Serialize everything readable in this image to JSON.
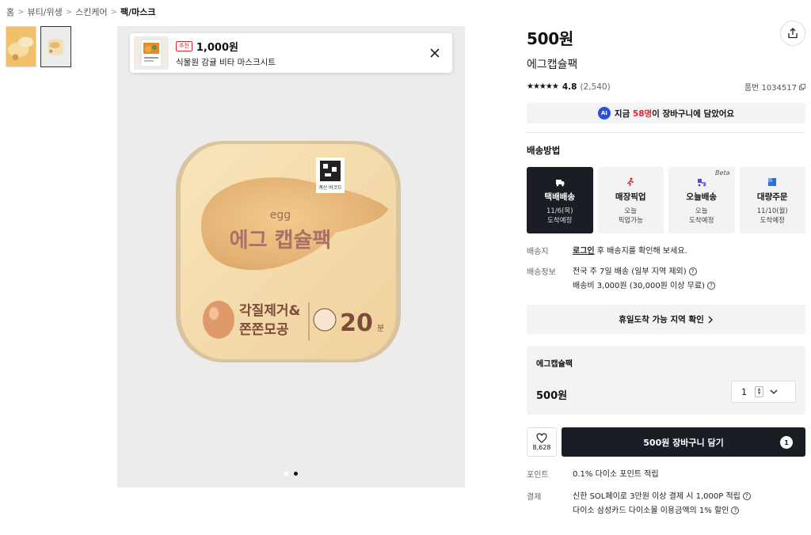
{
  "breadcrumb": [
    "홈",
    "뷰티/위생",
    "스킨케어",
    "팩/마스크"
  ],
  "breadcrumb_sep": ">",
  "recommend": {
    "badge": "추천",
    "price": "1,000원",
    "name": "식물원 감귤 비타 마스크시트"
  },
  "product_image": {
    "barcode_label": "계산 바코드",
    "eng": "egg",
    "title": "에그 캡슐팩",
    "feature1": "각질제거&",
    "feature2": "쫀쫀모공",
    "minutes": "20",
    "minutes_unit": "분",
    "thumb_label": "에그 캡슐"
  },
  "gallery": {
    "slide_count": 2,
    "active_slide": 2
  },
  "product": {
    "price": "500원",
    "name": "에그캡슐팩",
    "stars": "★★★★★",
    "rating": "4.8",
    "review_count": "(2,540)",
    "sku": "품번 1034517"
  },
  "cart_notice": {
    "ai": "AI",
    "prefix": "지금 ",
    "count": "58명",
    "suffix": "이 장바구니에 담았어요"
  },
  "shipping": {
    "title": "배송방법",
    "options": [
      {
        "label": "택배배송",
        "sub1": "11/6(목)",
        "sub2": "도착예정",
        "icon": "truck-icon"
      },
      {
        "label": "매장픽업",
        "sub1": "오늘",
        "sub2": "픽업가능",
        "icon": "runner-icon"
      },
      {
        "label": "오늘배송",
        "sub1": "오늘",
        "sub2": "도착예정",
        "icon": "scooter-icon",
        "badge": "Beta"
      },
      {
        "label": "대량주문",
        "sub1": "11/10(월)",
        "sub2": "도착예정",
        "icon": "box-icon"
      }
    ]
  },
  "delivery_info": {
    "dest_key": "배송지",
    "dest_login": "로그인",
    "dest_text": " 후 배송지를 확인해 보세요.",
    "info_key": "배송정보",
    "info_line1": "전국 주 7일 배송 (일부 지역 제외)",
    "info_line2": "배송비 3,000원 (30,000원 이상 무료)"
  },
  "holiday_check": "휴일도착 가능 지역 확인",
  "option": {
    "name": "에그캡슐팩",
    "price": "500원",
    "qty": "1"
  },
  "wish_count": "8,628",
  "cart_button": "500원 장바구니 담기",
  "cart_badge": "1",
  "benefits": {
    "point_key": "포인트",
    "point_value": "0.1% 다이소 포인트 적립",
    "pay_key": "결제",
    "pay_line1": "신한 SOL페이로 3만원 이상 결제 시 1,000P 적립",
    "pay_line2": "다이소 삼성카드 다이소몰 이용금액의 1% 할인"
  },
  "colors": {
    "accent_red": "#e3262f",
    "dark": "#1a1d23",
    "ai_blue": "#2c4fd6"
  }
}
